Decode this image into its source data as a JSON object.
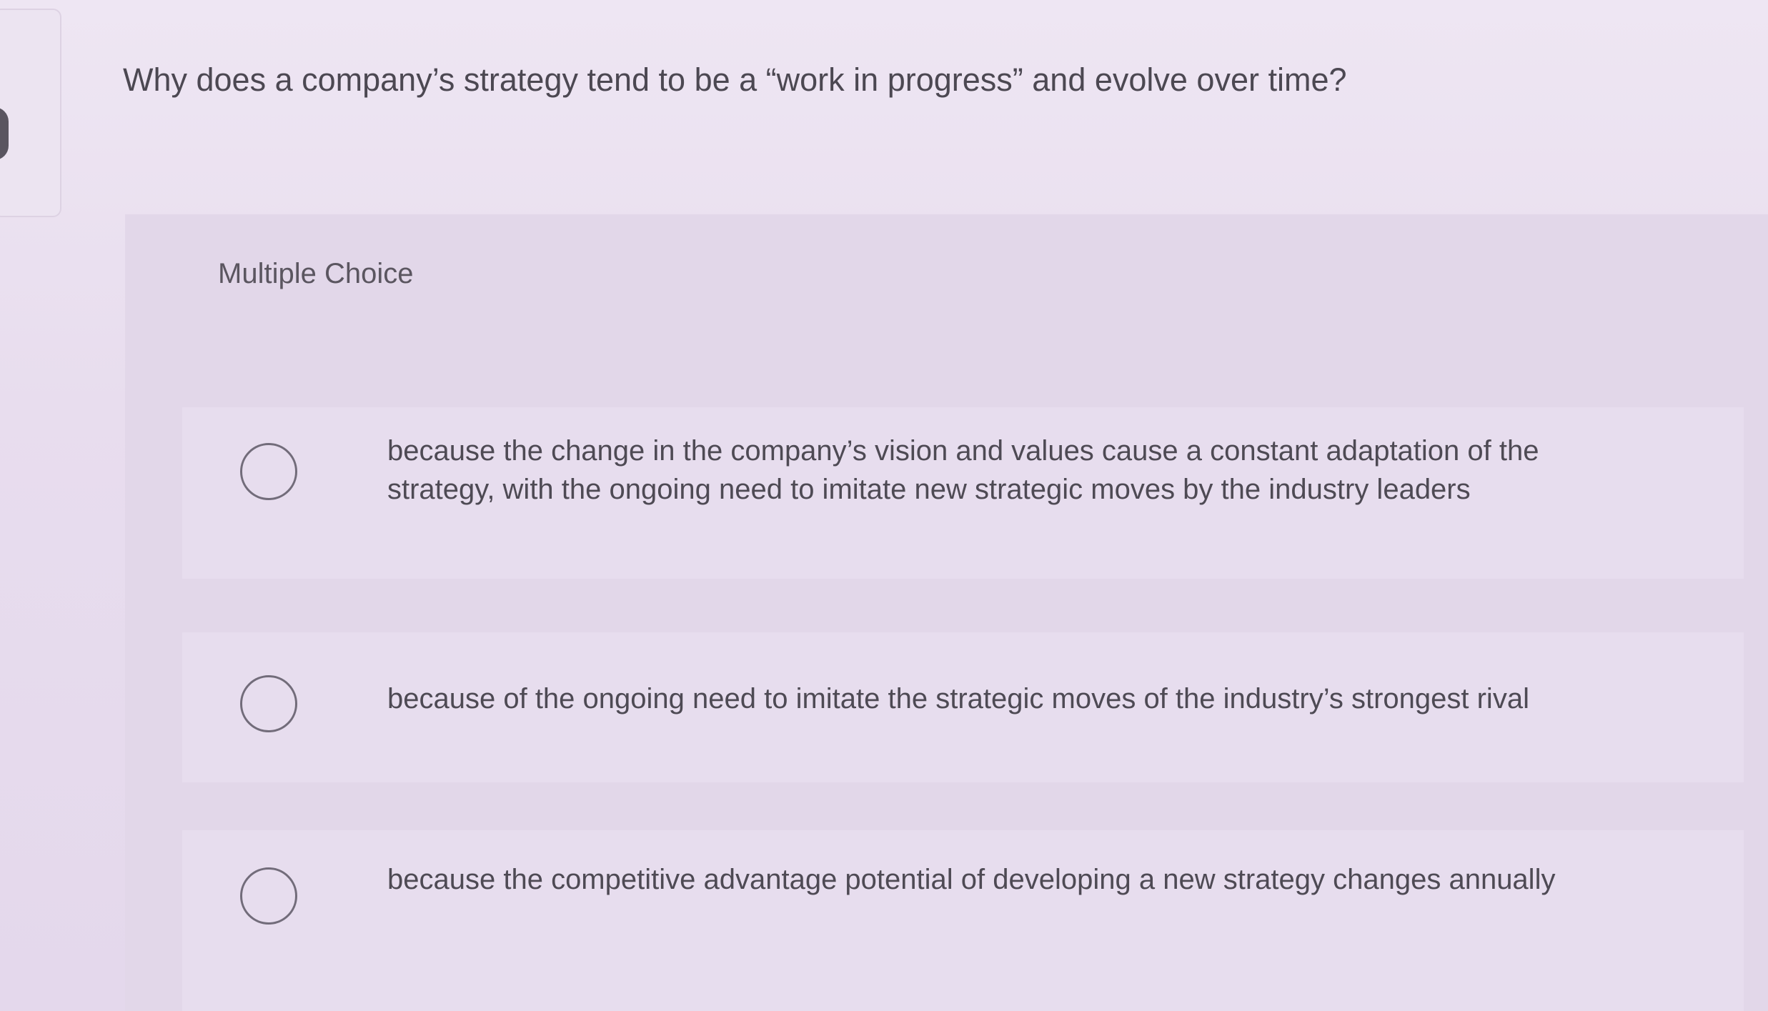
{
  "question": {
    "text": "Why does a company’s strategy tend to be a “work in progress” and evolve over time?"
  },
  "panel": {
    "label": "Multiple Choice"
  },
  "options": [
    {
      "text": "because the change in the company’s vision and values cause a constant adaptation of the strategy, with the ongoing need to imitate new strategic moves by the industry leaders",
      "selected": false
    },
    {
      "text": "because of the ongoing need to imitate the strategic moves of the industry’s strongest rival",
      "selected": false
    },
    {
      "text": "because the competitive advantage potential of developing a new strategy changes annually",
      "selected": false
    }
  ],
  "colors": {
    "background": "#e8ddee",
    "panel": "#e2d7e9",
    "text": "#4e4a54",
    "radio_border": "#726c7a"
  },
  "icons": {
    "radio": "radio-unchecked-icon"
  }
}
